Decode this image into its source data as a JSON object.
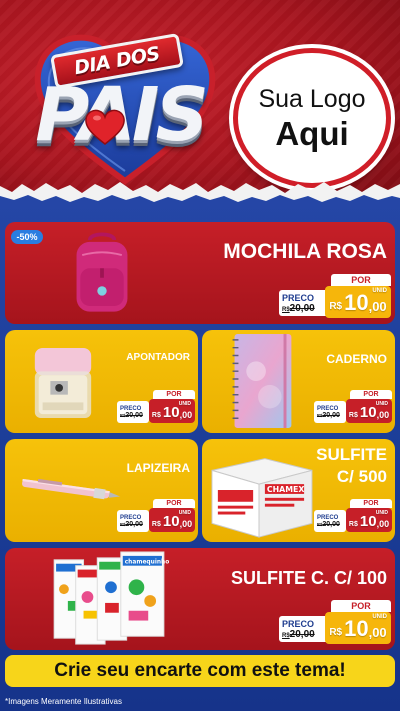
{
  "header": {
    "ribbon_text": "DIA DOS",
    "main_text": "PAIS",
    "logo_line1": "Sua Logo",
    "logo_line2": "Aqui"
  },
  "colors": {
    "red": "#c61f28",
    "yellow": "#f6c20a",
    "blue": "#1f3d8f",
    "cta_yellow": "#f7d51a"
  },
  "products": [
    {
      "name": "MOCHILA ROSA",
      "badge": "-50%",
      "price_label": "PRECO",
      "por_label": "POR",
      "old_prefix": "R$",
      "old_price": "20,00",
      "currency": "R$",
      "new_int": "10",
      "new_dec": ",00",
      "unit": "UNID",
      "icon": "backpack-icon"
    },
    {
      "name": "APONTADOR",
      "price_label": "PRECO",
      "por_label": "POR",
      "old_prefix": "R$",
      "old_price": "20,00",
      "currency": "R$",
      "new_int": "10",
      "new_dec": ",00",
      "unit": "UNID",
      "icon": "sharpener-icon"
    },
    {
      "name": "CADERNO",
      "price_label": "PRECO",
      "por_label": "POR",
      "old_prefix": "R$",
      "old_price": "20,00",
      "currency": "R$",
      "new_int": "10",
      "new_dec": ",00",
      "unit": "UNID",
      "icon": "notebook-icon"
    },
    {
      "name": "LAPIZEIRA",
      "price_label": "PRECO",
      "por_label": "POR",
      "old_prefix": "R$",
      "old_price": "20,00",
      "currency": "R$",
      "new_int": "10",
      "new_dec": ",00",
      "unit": "UNID",
      "icon": "pencil-icon"
    },
    {
      "name_line1": "SULFITE",
      "name_line2": "C/ 500",
      "price_label": "PRECO",
      "por_label": "POR",
      "old_prefix": "R$",
      "old_price": "20,00",
      "currency": "R$",
      "new_int": "10",
      "new_dec": ",00",
      "unit": "UNID",
      "icon": "paper-box-icon",
      "brand": "CHAMEX"
    },
    {
      "name": "SULFITE C. C/ 100",
      "price_label": "PRECO",
      "por_label": "POR",
      "old_prefix": "R$",
      "old_price": "20,00",
      "currency": "R$",
      "new_int": "10",
      "new_dec": ",00",
      "unit": "UNID",
      "icon": "colored-paper-icon",
      "brand": "chamequinho"
    }
  ],
  "cta": "Crie seu encarte com este tema!",
  "footnote": "*Imagens Meramente Ilustrativas"
}
